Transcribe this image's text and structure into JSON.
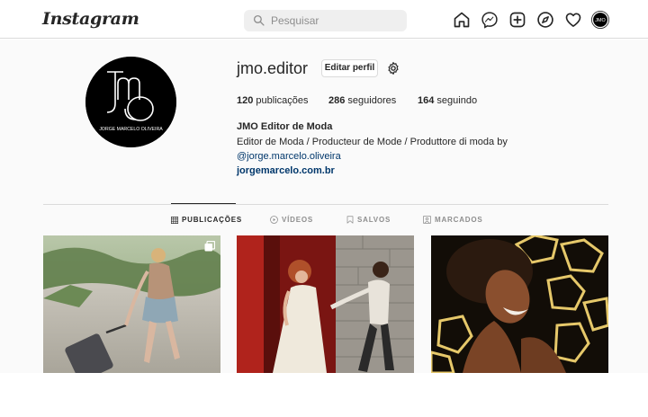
{
  "header": {
    "logo": "Instagram",
    "search_placeholder": "Pesquisar",
    "nav_icons": [
      "home-icon",
      "messenger-icon",
      "new-post-icon",
      "explore-icon",
      "activity-heart-icon",
      "profile-avatar-icon"
    ]
  },
  "profile": {
    "username": "jmo.editor",
    "edit_label": "Editar perfil",
    "stats": {
      "posts_count": "120",
      "posts_label": "publicações",
      "followers_count": "286",
      "followers_label": "seguidores",
      "following_count": "164",
      "following_label": "seguindo"
    },
    "full_name": "JMO Editor de Moda",
    "bio": "Editor de Moda / Producteur de Mode / Produttore di moda by",
    "mention": "@jorge.marcelo.oliveira",
    "website": "jorgemarcelo.com.br",
    "avatar_text": "JORGE MARCELO OLIVEIRA",
    "avatar_mono": "JMO"
  },
  "tabs": [
    {
      "label": "PUBLICAÇÕES",
      "icon": "grid-icon",
      "active": true
    },
    {
      "label": "VÍDEOS",
      "icon": "video-icon",
      "active": false
    },
    {
      "label": "SALVOS",
      "icon": "bookmark-icon",
      "active": false
    },
    {
      "label": "MARCADOS",
      "icon": "tagged-icon",
      "active": false
    }
  ],
  "colors": {
    "text": "#262626",
    "link": "#00376b",
    "muted": "#8e8e8e",
    "border": "#dbdbdb",
    "background": "#fafafa"
  }
}
